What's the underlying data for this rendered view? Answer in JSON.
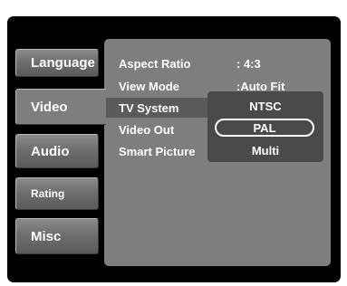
{
  "tabs": [
    {
      "label": "Language"
    },
    {
      "label": "Video"
    },
    {
      "label": "Audio"
    },
    {
      "label": "Rating"
    },
    {
      "label": "Misc"
    }
  ],
  "active_tab": "Video",
  "settings": [
    {
      "label": "Aspect Ratio",
      "value": ": 4:3"
    },
    {
      "label": "View Mode",
      "value": ":Auto Fit"
    },
    {
      "label": "TV System"
    },
    {
      "label": "Video Out"
    },
    {
      "label": "Smart Picture"
    }
  ],
  "dropdown": {
    "options": [
      "NTSC",
      "PAL",
      "Multi"
    ],
    "selected": "PAL"
  }
}
